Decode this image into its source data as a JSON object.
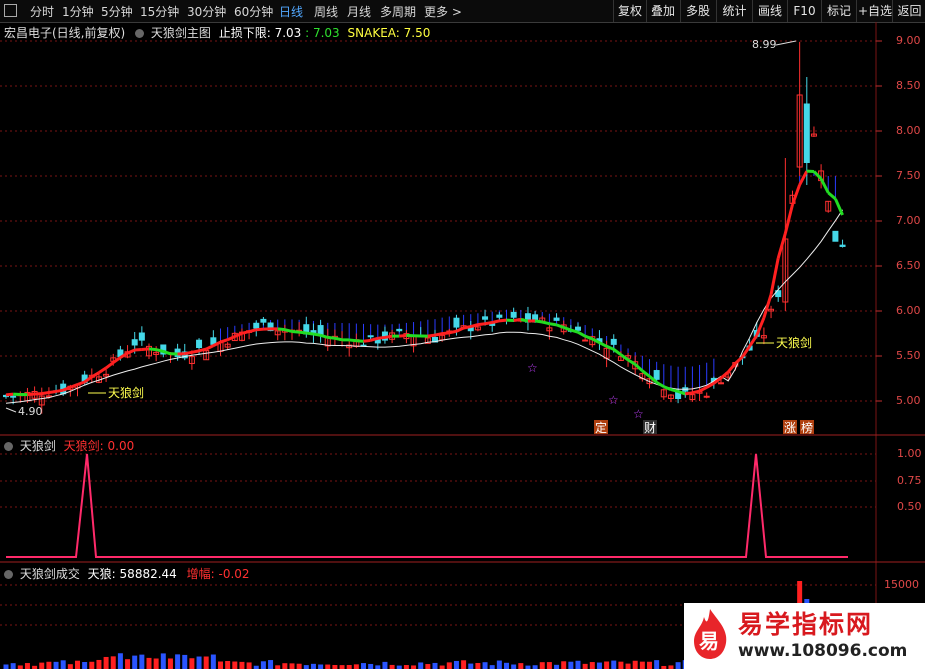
{
  "tabs": [
    {
      "label": "分时",
      "active": false
    },
    {
      "label": "1分钟",
      "active": false
    },
    {
      "label": "5分钟",
      "active": false
    },
    {
      "label": "15分钟",
      "active": false
    },
    {
      "label": "30分钟",
      "active": false
    },
    {
      "label": "60分钟",
      "active": false
    },
    {
      "label": "日线",
      "active": true
    },
    {
      "label": "周线",
      "active": false
    },
    {
      "label": "月线",
      "active": false
    },
    {
      "label": "多周期",
      "active": false
    },
    {
      "label": "更多 >",
      "active": false
    }
  ],
  "right_buttons": [
    "复权",
    "叠加",
    "多股",
    "统计",
    "画线",
    "F10",
    "标记",
    "+自选",
    "返回"
  ],
  "main_pane": {
    "stock": "宏昌电子(日线,前复权)",
    "indicator": "天狼剑主图",
    "stop_label": "止损下限:",
    "stop_value": "7.03",
    "stop_value2": ": 7.03",
    "snake_label": "SNAKEA:",
    "snake_value": "7.50",
    "price_axis": [
      "9.00",
      "8.50",
      "8.00",
      "7.50",
      "7.00",
      "6.50",
      "6.00",
      "5.50",
      "5.00"
    ],
    "high_marker": "8.99",
    "low_marker": "4.90",
    "signal_labels": [
      "天狼剑",
      "天狼剑"
    ],
    "tags": [
      "定",
      "财",
      "涨",
      "榜"
    ]
  },
  "pane2": {
    "title": "天狼剑",
    "sub": "天狼剑:",
    "value": "0.00",
    "axis": [
      "1.00",
      "0.75",
      "0.50"
    ]
  },
  "pane3": {
    "title": "天狼剑成交",
    "vol_label": "天狼:",
    "vol_value": "58882.44",
    "inc_label": "增幅:",
    "inc_value": "-0.02",
    "axis": [
      "15000"
    ]
  },
  "watermark": {
    "title": "易学指标网",
    "url": "www.108096.com",
    "logo_char": "易"
  },
  "colors": {
    "up": "#ff3030",
    "down": "#45d8e8",
    "ma_red": "#ff2020",
    "ma_green": "#22dd22",
    "grid": "#7a1515"
  }
}
